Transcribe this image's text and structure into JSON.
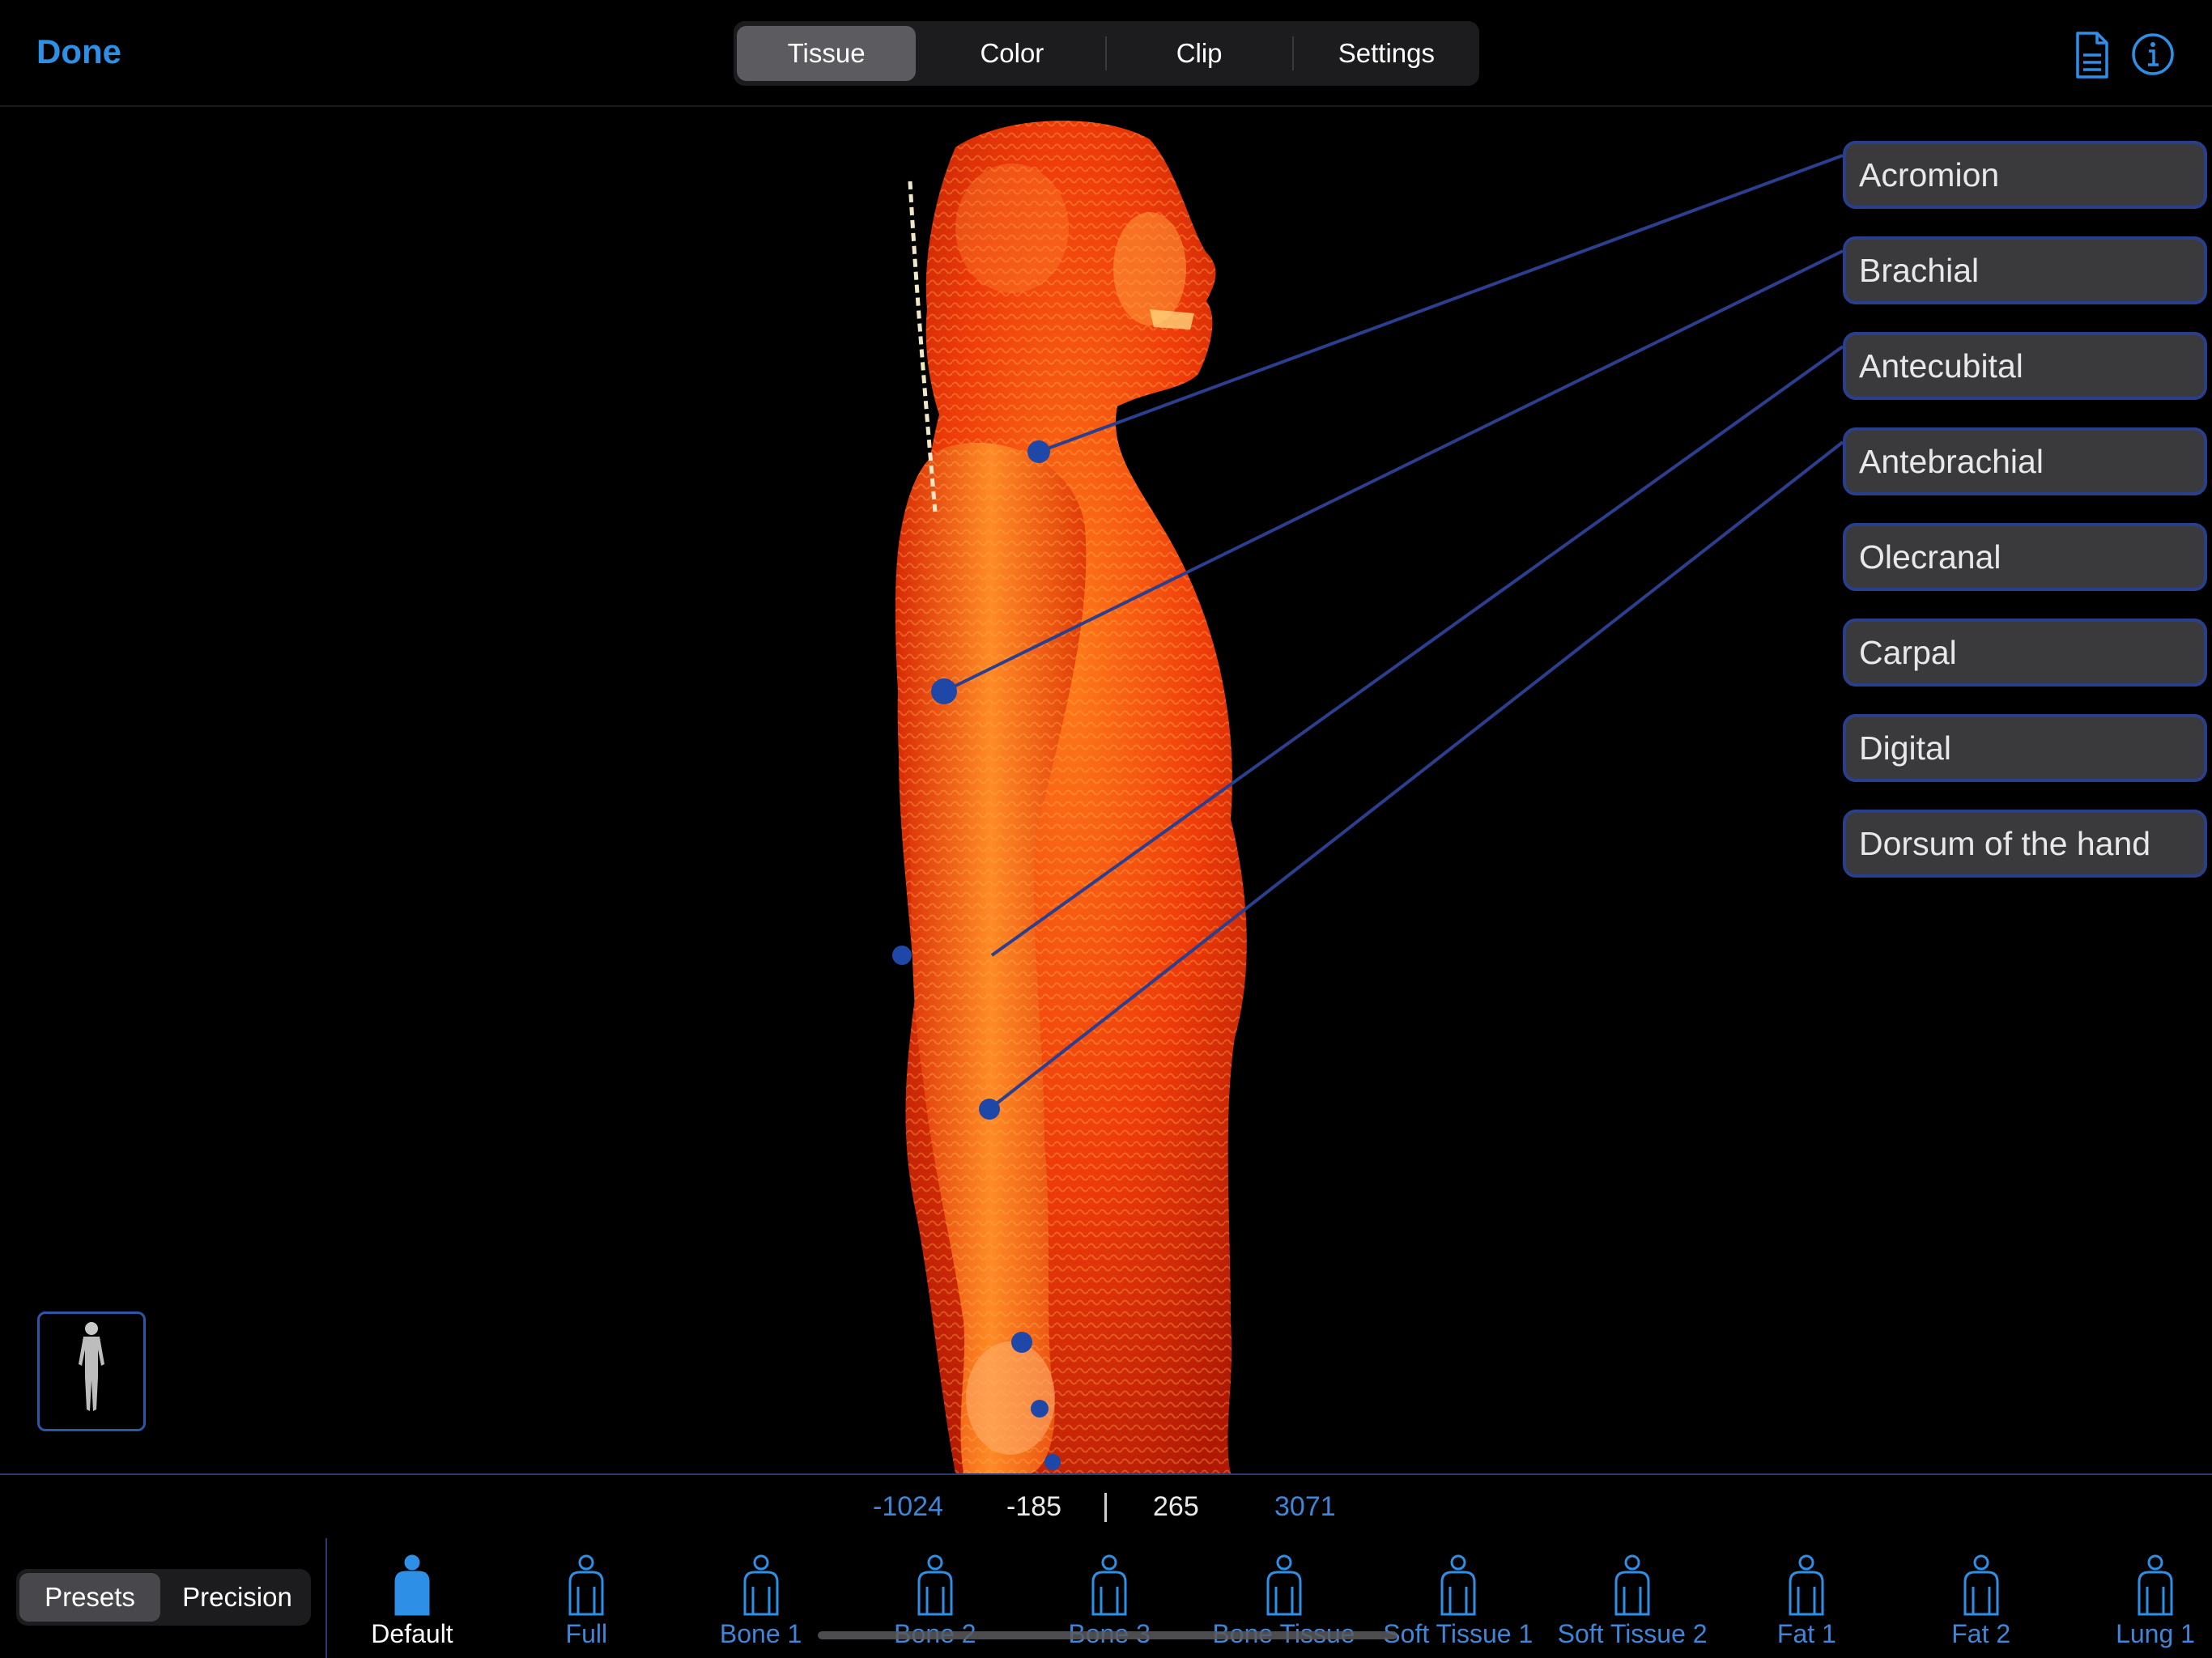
{
  "topbar": {
    "done_label": "Done",
    "tabs": [
      "Tissue",
      "Color",
      "Clip",
      "Settings"
    ],
    "active_tab": "Tissue"
  },
  "labels": [
    "Acromion",
    "Brachial",
    "Antecubital",
    "Antebrachial",
    "Olecranal",
    "Carpal",
    "Digital",
    "Dorsum of the hand"
  ],
  "window": {
    "min": "-1024",
    "low": "-185",
    "high": "265",
    "max": "3071"
  },
  "modes": [
    "Presets",
    "Precision"
  ],
  "active_mode": "Presets",
  "presets": [
    "Default",
    "Full",
    "Bone 1",
    "Bone 2",
    "Bone 3",
    "Bone Tissue",
    "Soft Tissue 1",
    "Soft Tissue 2",
    "Fat 1",
    "Fat 2",
    "Lung 1"
  ],
  "active_preset": "Default",
  "colors": {
    "accent": "#2e8fe6",
    "panel": "#3a3a3c",
    "panel_border": "#2a3f8c",
    "marker": "#1f47a8"
  }
}
